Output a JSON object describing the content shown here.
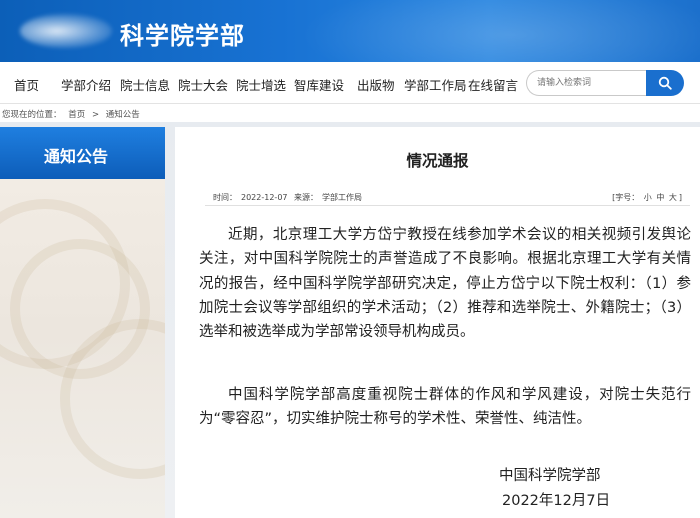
{
  "header": {
    "title": "科学院学部"
  },
  "nav": {
    "items": [
      "首页",
      "学部介绍",
      "院士信息",
      "院士大会",
      "院士增选",
      "智库建设",
      "出版物",
      "学部工作局",
      "在线留言"
    ],
    "search_placeholder": "请输入检索词"
  },
  "breadcrumb": {
    "prefix": "您现在的位置：",
    "items": [
      "首页",
      ">",
      "通知公告"
    ]
  },
  "sidebar": {
    "heading": "通知公告"
  },
  "article": {
    "title": "情况通报",
    "meta": {
      "time_label": "时间：",
      "time": "2022-12-07",
      "source_label": "来源：",
      "source": "学部工作局"
    },
    "font_size": {
      "label": "[字号：",
      "small": "小",
      "medium": "中",
      "large": "大",
      "close": "]"
    },
    "paragraphs": [
      "近期，北京理工大学方岱宁教授在线参加学术会议的相关视频引发舆论关注，对中国科学院院士的声誉造成了不良影响。根据北京理工大学有关情况的报告，经中国科学院学部研究决定，停止方岱宁以下院士权利：（1）参加院士会议等学部组织的学术活动；（2）推荐和选举院士、外籍院士；（3）选举和被选举成为学部常设领导机构成员。",
      "中国科学院学部高度重视院士群体的作风和学风建设，对院士失范行为“零容忍”，切实维护院士称号的学术性、荣誉性、纯洁性。"
    ],
    "signature": "中国科学院学部",
    "date": "2022年12月7日"
  },
  "colors": {
    "brand_blue": "#1a6fce",
    "sidebar_blue": "#0d5db9",
    "background": "#e7ebf0"
  }
}
